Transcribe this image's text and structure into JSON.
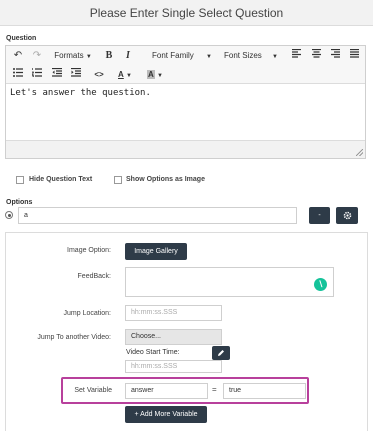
{
  "dialog": {
    "title": "Please Enter Single Select Question"
  },
  "question": {
    "label": "Question",
    "toolbar": {
      "formats_label": "Formats",
      "bold_label": "B",
      "italic_label": "I",
      "font_family_label": "Font Family",
      "font_sizes_label": "Font Sizes",
      "code_label": "<>",
      "text_color_label": "A",
      "bg_color_label": "A"
    },
    "content": "Let's answer the question."
  },
  "checkboxes": {
    "hide_question_text": "Hide Question Text",
    "show_options_as_image": "Show Options as Image"
  },
  "options": {
    "label": "Options",
    "option_value": "a",
    "remove_label": "-"
  },
  "option_detail": {
    "image_option_label": "Image Option:",
    "image_gallery_button": "Image Gallery",
    "feedback_label": "FeedBack:",
    "jump_location_label": "Jump Location:",
    "jump_location_placeholder": "hh:mm:ss.SSS",
    "jump_video_label": "Jump To another Video:",
    "choose_label": "Choose...",
    "video_start_time_label": "Video Start Time:",
    "video_start_placeholder": "hh:mm:ss.SSS",
    "set_variable_label": "Set Variable",
    "variable_name_value": "answer",
    "equals_label": "=",
    "variable_value": "true",
    "add_more_variable_label": "+ Add More Variable"
  },
  "colors": {
    "highlight": "#b8409c",
    "dark_button": "#2e3b48",
    "grammarly_green": "#15c39a"
  }
}
